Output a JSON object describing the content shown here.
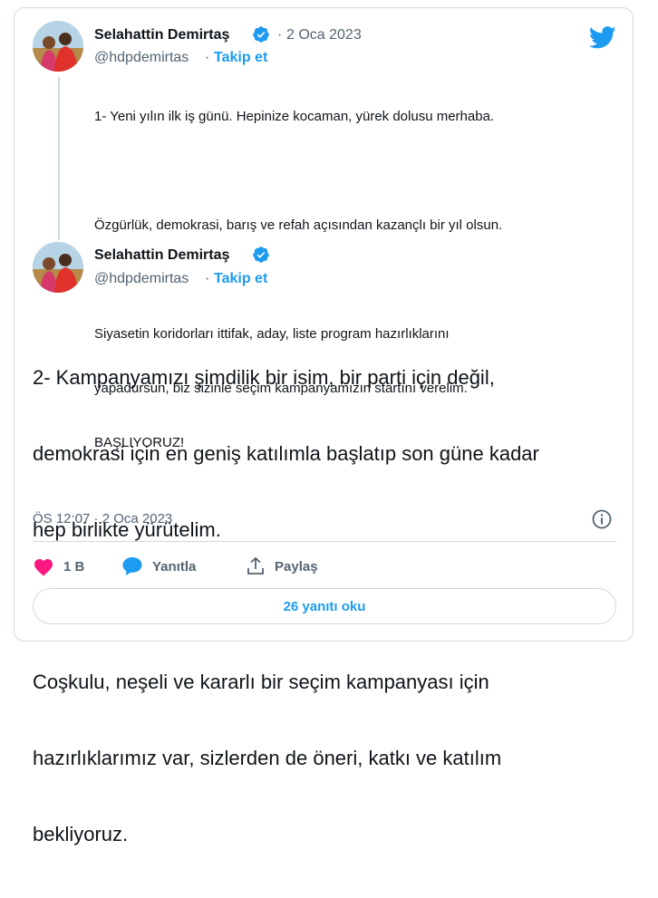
{
  "tweet1": {
    "author_name": "Selahattin Demirtaş",
    "handle": "@hdpdemirtas",
    "separator": "·",
    "date": "2 Oca 2023",
    "follow_label": "Takip et",
    "lines": [
      "1- Yeni yılın ilk iş günü. Hepinize kocaman, yürek dolusu merhaba.",
      "",
      "Özgürlük, demokrasi, barış ve refah açısından kazançlı bir yıl olsun.",
      "",
      "Siyasetin koridorları ittifak, aday, liste program hazırlıklarını",
      "yapadursun, biz sizinle seçim kampanyamızın startını verelim.",
      "BAŞLIYORUZ!"
    ]
  },
  "tweet2": {
    "author_name": "Selahattin Demirtaş",
    "handle": "@hdpdemirtas",
    "separator": "·",
    "follow_label": "Takip et",
    "lines": [
      "2- Kampanyamızı şimdilik bir isim, bir parti için değil,",
      "demokrasi için en geniş katılımla başlatıp son güne kadar",
      "hep birlikte yürütelim.",
      "",
      "Coşkulu, neşeli ve kararlı bir seçim kampanyası için",
      "hazırlıklarımız var, sizlerden de öneri, katkı ve katılım",
      "bekliyoruz."
    ],
    "timestamp": "ÖS 12:07 · 2 Oca 2023"
  },
  "actions": {
    "like_count": "1 B",
    "reply_label": "Yanıtla",
    "share_label": "Paylaş"
  },
  "read_replies_label": "26 yanıtı oku",
  "colors": {
    "accent": "#1d9bf0",
    "like": "#f91880",
    "text": "#0f1419",
    "secondary": "#536471",
    "border": "#cfd9de"
  }
}
